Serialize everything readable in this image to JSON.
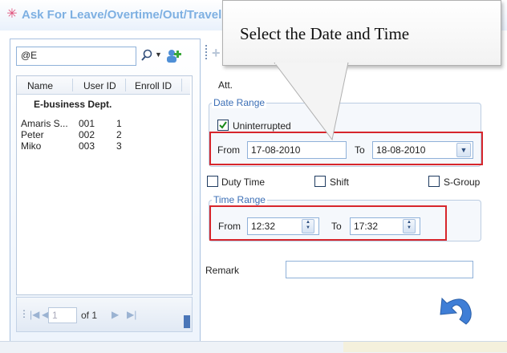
{
  "window": {
    "title": "Ask For Leave/Overtime/Out/Travel"
  },
  "search": {
    "value": "@E"
  },
  "employee_list": {
    "columns": [
      "Name",
      "User ID",
      "Enroll ID"
    ],
    "department": "E-business Dept.",
    "rows": [
      {
        "name": "Amaris S...",
        "user_id": "001",
        "enroll_id": "1"
      },
      {
        "name": "Peter",
        "user_id": "002",
        "enroll_id": "2"
      },
      {
        "name": "Miko",
        "user_id": "003",
        "enroll_id": "3"
      }
    ]
  },
  "pager": {
    "current_page": "1",
    "of_label": "of 1"
  },
  "form": {
    "att_label": "Att.",
    "date_range": {
      "legend": "Date Range",
      "uninterrupted_label": "Uninterrupted",
      "uninterrupted_checked": true,
      "from_label": "From",
      "from_value": "17-08-2010",
      "to_label": "To",
      "to_value": "18-08-2010"
    },
    "options": {
      "duty_time_label": "Duty Time",
      "shift_label": "Shift",
      "s_group_label": "S-Group"
    },
    "time_range": {
      "legend": "Time Range",
      "from_label": "From",
      "from_value": "12:32",
      "to_label": "To",
      "to_value": "17:32"
    },
    "remark_label": "Remark",
    "remark_value": ""
  },
  "callout": {
    "text": "Select the Date and Time"
  },
  "colors": {
    "highlight_border": "#d7262c",
    "title_text": "#7eb0e2",
    "legend_text": "#3c6fb6"
  },
  "icons": [
    "app-icon",
    "search-icon",
    "add-user-icon",
    "plus-icon",
    "first-page-icon",
    "prev-page-icon",
    "next-page-icon",
    "last-page-icon",
    "back-arrow-icon"
  ]
}
